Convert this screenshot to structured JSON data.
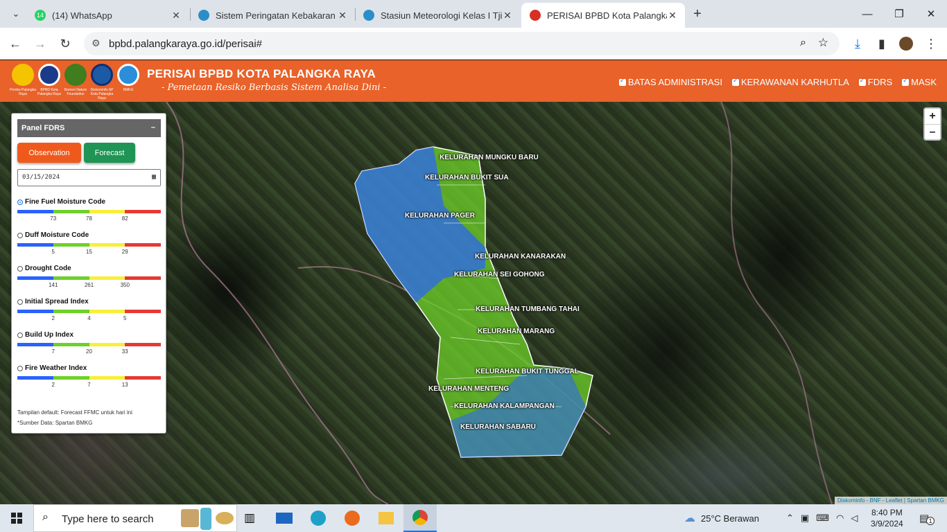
{
  "browser": {
    "tabs": [
      {
        "title": "(14) WhatsApp",
        "badge": "14",
        "icon": "whatsapp-icon",
        "color": "#25d366"
      },
      {
        "title": "Sistem Peringatan Kebakaran H",
        "icon": "site-icon",
        "color": "#2c8ec9"
      },
      {
        "title": "Stasiun Meteorologi Kelas I Tjilik",
        "icon": "site-icon",
        "color": "#2c8ec9"
      },
      {
        "title": "PERISAI BPBD Kota Palangka Ra",
        "icon": "bpbd-icon",
        "color": "#d93025"
      }
    ],
    "url": "bpbd.palangkaraya.go.id/perisai#"
  },
  "header": {
    "title": "PERISAI BPBD KOTA PALANGKA RAYA",
    "tagline": "- Pemetaan Resiko Berbasis Sistem Analisa Dini -",
    "logos": [
      {
        "caption": "Pemko Palangka Raya",
        "color": "#f4c400"
      },
      {
        "caption": "BPBD Kota Palangka Raya",
        "color": "#1a3a8a"
      },
      {
        "caption": "Borneo Nature Foundation",
        "color": "#3f7d1f"
      },
      {
        "caption": "Diskominfo-SP Kota Palangka Raya",
        "color": "#1c5aa6"
      },
      {
        "caption": "BMKG",
        "color": "#2a8fd8"
      }
    ],
    "layers": [
      "BATAS ADMINISTRASI",
      "KERAWANAN KARHUTLA",
      "FDRS",
      "MASK"
    ]
  },
  "panel": {
    "title": "Panel FDRS",
    "minimize": "–",
    "btn_observation": "Observation",
    "btn_forecast": "Forecast",
    "date": "03/15/2024",
    "indices": [
      {
        "name": "Fine Fuel Moisture Code",
        "selected": true,
        "ticks": [
          "73",
          "78",
          "82"
        ]
      },
      {
        "name": "Duff Moisture Code",
        "selected": false,
        "ticks": [
          "5",
          "15",
          "29"
        ]
      },
      {
        "name": "Drought Code",
        "selected": false,
        "ticks": [
          "141",
          "261",
          "350"
        ]
      },
      {
        "name": "Initial Spread Index",
        "selected": false,
        "ticks": [
          "2",
          "4",
          "5"
        ]
      },
      {
        "name": "Build Up Index",
        "selected": false,
        "ticks": [
          "7",
          "20",
          "33"
        ]
      },
      {
        "name": "Fire Weather Index",
        "selected": false,
        "ticks": [
          "2",
          "7",
          "13"
        ]
      }
    ],
    "scale_colors": [
      "#2962ff",
      "#6ed02a",
      "#f7ef3a",
      "#e53935"
    ],
    "note1": "Tampilan default: Forecast FFMC untuk hari ini",
    "note2": "*Sumber Data: Spartan BMKG"
  },
  "map": {
    "zoom_in": "+",
    "zoom_out": "–",
    "kelurahan": [
      "KELURAHAN MUNGKU BARU",
      "KELURAHAN BUKIT SUA",
      "KELURAHAN PAGER",
      "KELURAHAN KANARAKAN",
      "KELURAHAN SEI GOHONG",
      "KELURAHAN TUMBANG TAHAI",
      "KELURAHAN MARANG",
      "KELURAHAN BUKIT TUNGGAL",
      "KELURAHAN MENTENG",
      "KELURAHAN KALAMPANGAN",
      "KELURAHAN SABARU"
    ],
    "attribution": "Diskominfo - BNF - Leaflet | Spartan BMKG"
  },
  "taskbar": {
    "search_placeholder": "Type here to search",
    "weather": "25°C  Berawan",
    "time": "8:40 PM",
    "date": "3/9/2024",
    "notifications": "1"
  }
}
